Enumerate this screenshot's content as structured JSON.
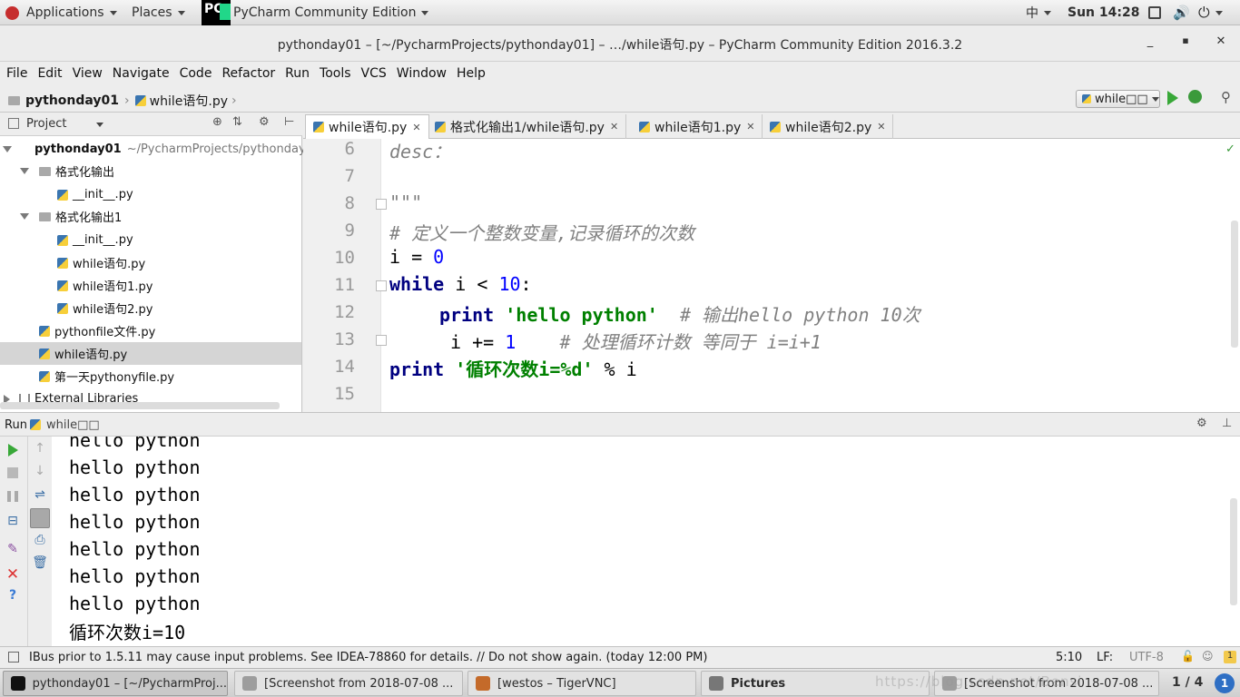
{
  "top_panel": {
    "applications": "Applications",
    "places": "Places",
    "app_name": "PyCharm Community Edition",
    "input_method": "中",
    "clock": "Sun 14:28"
  },
  "window": {
    "title": "pythonday01 – [~/PycharmProjects/pythonday01] – …/while语句.py – PyCharm Community Edition 2016.3.2"
  },
  "menu": [
    "File",
    "Edit",
    "View",
    "Navigate",
    "Code",
    "Refactor",
    "Run",
    "Tools",
    "VCS",
    "Window",
    "Help"
  ],
  "navbar": {
    "project": "pythonday01",
    "file": "while语句.py",
    "run_config": "while□□"
  },
  "project_pane": {
    "title": "Project",
    "root_name": "pythonday01",
    "root_path": "~/PycharmProjects/pythonday",
    "items": [
      {
        "label": "格式化输出"
      },
      {
        "label": "__init__.py"
      },
      {
        "label": "格式化输出1"
      },
      {
        "label": "__init__.py"
      },
      {
        "label": "while语句.py"
      },
      {
        "label": "while语句1.py"
      },
      {
        "label": "while语句2.py"
      },
      {
        "label": "pythonfile文件.py"
      },
      {
        "label": "while语句.py"
      },
      {
        "label": "第一天pythonyfile.py"
      },
      {
        "label": "External Libraries"
      }
    ]
  },
  "tabs": [
    {
      "label": "while语句.py"
    },
    {
      "label": "格式化输出1/while语句.py"
    },
    {
      "label": "while语句1.py"
    },
    {
      "label": "while语句2.py"
    }
  ],
  "editor": {
    "line_numbers": [
      "6",
      "7",
      "8",
      "9",
      "10",
      "11",
      "12",
      "13",
      "14",
      "15"
    ],
    "l6": "desc：",
    "l8": "\"\"\"",
    "l9": "# 定义一个整数变量,记录循环的次数",
    "l10_a": "i = ",
    "l10_b": "0",
    "l11_kw": "while",
    "l11_a": " i < ",
    "l11_b": "10",
    "l11_c": ":",
    "l12_kw": "print",
    "l12_str": "'hello python'",
    "l12_cmt": "# 输出hello python 10次",
    "l13_a": "i += ",
    "l13_b": "1",
    "l13_cmt": "# 处理循环计数 等同于 i=i+1",
    "l14_kw": "print",
    "l14_str": "'循环次数i=%d'",
    "l14_a": " % i"
  },
  "run_pane": {
    "label": "Run",
    "config": "while□□",
    "output": [
      "hello python",
      "hello python",
      "hello python",
      "hello python",
      "hello python",
      "hello python",
      "hello python",
      "循环次数i=10"
    ]
  },
  "status_bar": {
    "message": "IBus prior to 1.5.11 may cause input problems. See IDEA-78860 for details. // Do not show again. (today 12:00 PM)",
    "position": "5:10",
    "line_sep": "LF:",
    "encoding": "UTF-8",
    "notifications": "1"
  },
  "taskbar": {
    "items": [
      {
        "label": "pythonday01 – [~/PycharmProj..."
      },
      {
        "label": "[Screenshot from 2018-07-08 ..."
      },
      {
        "label": "[westos – TigerVNC]"
      },
      {
        "label": "Pictures"
      },
      {
        "label": "[Screenshot from 2018-07-08 ..."
      }
    ],
    "workspace": "1 / 4",
    "workspace_badge": "1",
    "watermark": "https://blog.csdn.net/Bensi"
  },
  "colors": {
    "keyword": "#000080",
    "string": "#008000",
    "number": "#0000ff",
    "comment": "#808080"
  }
}
